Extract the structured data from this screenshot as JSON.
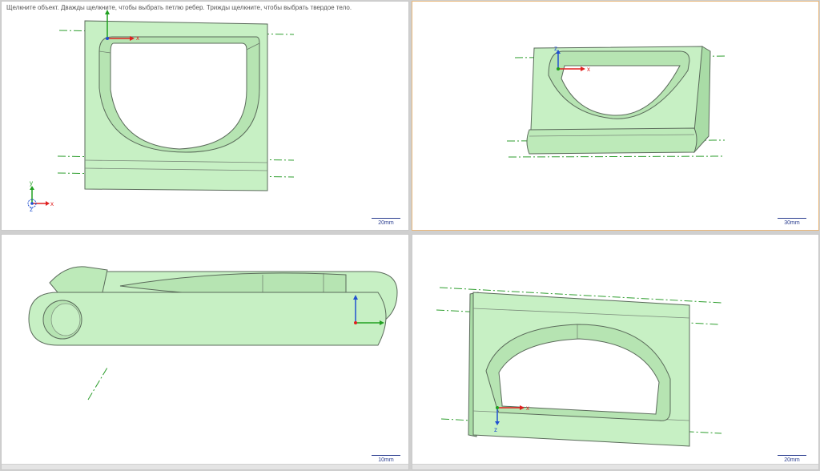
{
  "hint_text": "Щелкните объект. Дважды щелкните, чтобы выбрать петлю ребер. Трижды щелкните, чтобы выбрать твердое тело.",
  "axes": {
    "x": "x",
    "y": "y",
    "z": "z"
  },
  "viewports": {
    "top_left": {
      "scale_label": "20mm"
    },
    "top_right": {
      "scale_label": "30mm"
    },
    "bottom_left": {
      "scale_label": "10mm"
    },
    "bottom_right": {
      "scale_label": "20mm"
    }
  },
  "colors": {
    "part_fill": "#c7f0c4",
    "part_shade": "#a9dca6",
    "part_edge": "#5a6a5a",
    "centerline": "#2e9e2e",
    "axis_x": "#e02020",
    "axis_y": "#20a020",
    "axis_z": "#2050d0",
    "active_border": "#e8b77a"
  }
}
